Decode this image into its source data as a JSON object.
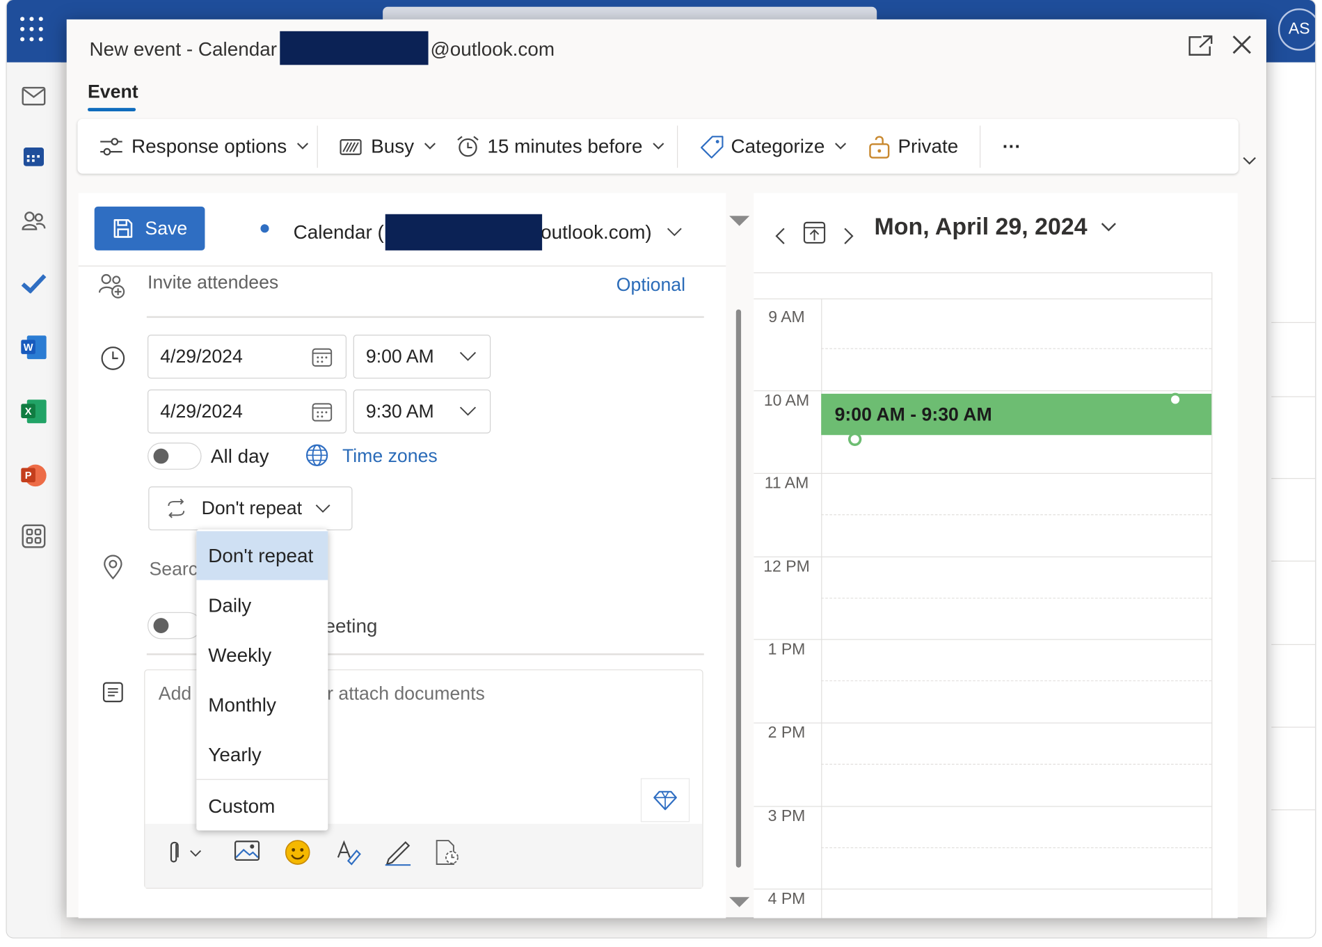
{
  "app": {
    "avatar_initials": "AS",
    "accent_color": "#1f4e9b"
  },
  "modal": {
    "title_prefix": "New event - Calendar",
    "title_suffix": "@outlook.com",
    "tab_event": "Event"
  },
  "ribbon": {
    "response_options": "Response options",
    "show_as": "Busy",
    "reminder": "15 minutes before",
    "categorize": "Categorize",
    "private": "Private",
    "more": "···"
  },
  "form": {
    "save_label": "Save",
    "calendar_prefix": "Calendar (",
    "calendar_suffix": "outlook.com)",
    "attendees_placeholder": "Invite attendees",
    "optional_label": "Optional",
    "start_date": "4/29/2024",
    "start_time": "9:00 AM",
    "end_date": "4/29/2024",
    "end_time": "9:30 AM",
    "all_day_label": "All day",
    "time_zones_label": "Time zones",
    "repeat_value": "Don't repeat",
    "location_placeholder": "Searc",
    "teams_label_fragment": "eeting",
    "body_placeholder_left": "Add",
    "body_placeholder_right": "r attach documents"
  },
  "repeat_dropdown": {
    "options": [
      "Don't repeat",
      "Daily",
      "Weekly",
      "Monthly",
      "Yearly",
      "Custom"
    ],
    "selected": "Don't repeat"
  },
  "calendar_pane": {
    "date_label": "Mon, April 29, 2024",
    "hours": [
      "9 AM",
      "10 AM",
      "11 AM",
      "12 PM",
      "1 PM",
      "2 PM",
      "3 PM",
      "4 PM"
    ],
    "event_time": "9:00 AM - 9:30 AM",
    "event_color": "#6dbd72"
  }
}
